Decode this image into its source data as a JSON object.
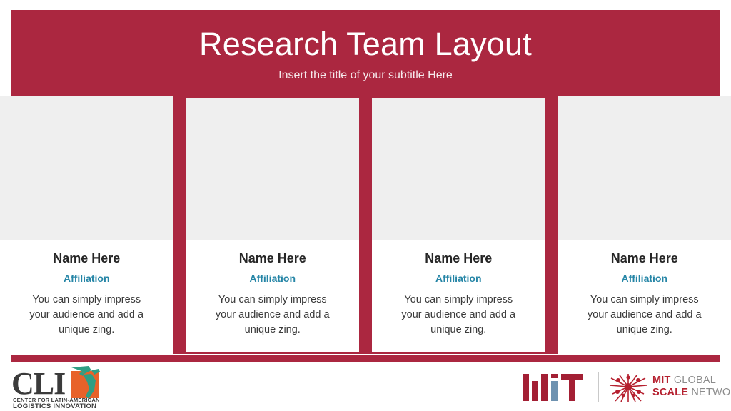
{
  "header": {
    "title": "Research Team Layout",
    "subtitle": "Insert the title of your subtitle Here",
    "background_color": "#ab2740",
    "title_color": "#ffffff"
  },
  "theme": {
    "accent_red": "#ab2740",
    "affiliation_blue": "#2585a6",
    "photo_placeholder": "#efefef",
    "card_background": "#ffffff",
    "body_text": "#3a3a3a"
  },
  "cards": [
    {
      "photo_alt": "photo-placeholder",
      "name": "Name Here",
      "affiliation": "Affiliation",
      "description": "You can simply impress your audience and add a unique zing."
    },
    {
      "photo_alt": "photo-placeholder",
      "name": "Name Here",
      "affiliation": "Affiliation",
      "description": "You can simply impress your audience and add a unique zing."
    },
    {
      "photo_alt": "photo-placeholder",
      "name": "Name Here",
      "affiliation": "Affiliation",
      "description": "You can simply impress your audience and add a unique zing."
    },
    {
      "photo_alt": "photo-placeholder",
      "name": "Name Here",
      "affiliation": "Affiliation",
      "description": "You can simply impress your audience and add a unique zing."
    }
  ],
  "footer": {
    "cli_logo": {
      "wordmark": "CLI",
      "tagline_line1": "CENTER FOR LATIN-AMERICAN",
      "tagline_line2": "LOGISTICS INNOVATION",
      "square_color": "#e8622a",
      "map_color": "#2f9e84"
    },
    "mit_logo": {
      "name": "MIT",
      "red": "#a31f34",
      "blue": "#6e92b0"
    },
    "scale_logo": {
      "line1_bold": "MIT",
      "line1_light": "GLOBAL",
      "line2_bold": "SCALE",
      "line2_light": "NETWORK",
      "red": "#b5202f",
      "gray": "#8c8c8c"
    }
  }
}
